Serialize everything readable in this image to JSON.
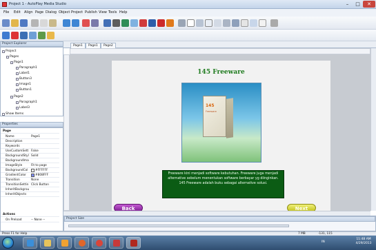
{
  "window": {
    "title": "Project 1 - AutoPlay Media Studio"
  },
  "menu": [
    "File",
    "Edit",
    "Align",
    "Page",
    "Dialog",
    "Object",
    "Project",
    "Publish",
    "View",
    "Tools",
    "Help"
  ],
  "project_explorer": {
    "title": "Project Explorer",
    "items": [
      {
        "label": "Project",
        "level": 0
      },
      {
        "label": "Pages",
        "level": 1
      },
      {
        "label": "Page1",
        "level": 2
      },
      {
        "label": "Paragraph1",
        "level": 3
      },
      {
        "label": "Label1",
        "level": 3
      },
      {
        "label": "Button3",
        "level": 3
      },
      {
        "label": "Image1",
        "level": 3
      },
      {
        "label": "Button1",
        "level": 3
      },
      {
        "label": "Page2",
        "level": 2
      },
      {
        "label": "Paragraph1",
        "level": 3
      },
      {
        "label": "Label3",
        "level": 3
      }
    ],
    "show_items_label": "Show Items"
  },
  "properties": {
    "title": "Properties",
    "section_page": "Page",
    "rows": [
      {
        "name": "Name",
        "value": "Page1"
      },
      {
        "name": "Description",
        "value": ""
      },
      {
        "name": "Keywords",
        "value": ""
      },
      {
        "name": "UseCustomSett",
        "value": "False"
      },
      {
        "name": "BackgroundStyl",
        "value": "Solid"
      },
      {
        "name": "BackgroundIma",
        "value": ""
      },
      {
        "name": "ImageStyle",
        "value": "Fit to page"
      },
      {
        "name": "BackgroundCol",
        "value": "#FFFFFF",
        "swatch": "#ffffff"
      },
      {
        "name": "GradientColor",
        "value": "#808FFF",
        "swatch": "#808fff"
      },
      {
        "name": "Transition",
        "value": "None"
      },
      {
        "name": "TransitionSettin",
        "value": "Click Button"
      },
      {
        "name": "InheritBackgrou",
        "value": ""
      },
      {
        "name": "InheritObjects",
        "value": ""
      }
    ],
    "section_actions": "Actions",
    "action_row": {
      "name": "On Preload",
      "value": "-- None --"
    }
  },
  "tabs": [
    "Page1",
    "Page1",
    "Page2"
  ],
  "page": {
    "title": "145 Freeware",
    "box_label": "145",
    "box_sub": "Freeware",
    "description": "Freeware kini menjadi software kebutuhan. Freeware juga menjadi alternative sebelum menentukan software berbayar yg diinginkan. 145 Freeware adalah buku sebagai alternative solusi.",
    "back_button": "Back",
    "next_button": "Next"
  },
  "project_size": {
    "title": "Project Size",
    "total": "7 MB",
    "cursor": "-131, 115"
  },
  "status": {
    "help_text": "Press F1 for Help"
  },
  "taskbar": {
    "language": "IN",
    "time": "11:48 AM",
    "date": "4/29/2013"
  },
  "colors": {
    "title_green": "#1d7a1d",
    "description_bg": "#0b5c14",
    "back_btn": "#9b33ad",
    "next_btn": "#d6d62a"
  }
}
